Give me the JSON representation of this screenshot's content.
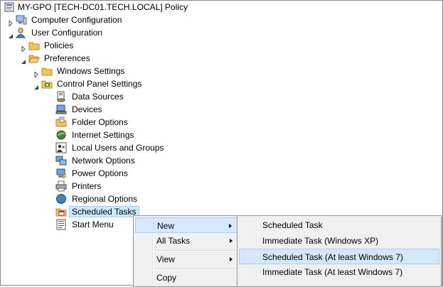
{
  "tree": {
    "root": "MY-GPO [TECH-DC01.TECH.LOCAL] Policy",
    "computer_configuration": "Computer Configuration",
    "user_configuration": "User Configuration",
    "policies": "Policies",
    "preferences": "Preferences",
    "windows_settings": "Windows Settings",
    "control_panel_settings": "Control Panel Settings",
    "items": [
      {
        "label": "Data Sources",
        "icon": "data-sources-icon"
      },
      {
        "label": "Devices",
        "icon": "devices-icon"
      },
      {
        "label": "Folder Options",
        "icon": "folder-options-icon"
      },
      {
        "label": "Internet Settings",
        "icon": "internet-settings-icon"
      },
      {
        "label": "Local Users and Groups",
        "icon": "local-users-icon"
      },
      {
        "label": "Network Options",
        "icon": "network-options-icon"
      },
      {
        "label": "Power Options",
        "icon": "power-options-icon"
      },
      {
        "label": "Printers",
        "icon": "printers-icon"
      },
      {
        "label": "Regional Options",
        "icon": "regional-options-icon"
      },
      {
        "label": "Scheduled Tasks",
        "icon": "scheduled-tasks-icon"
      },
      {
        "label": "Start Menu",
        "icon": "start-menu-icon"
      }
    ]
  },
  "context_menu": {
    "new": "New",
    "all_tasks": "All Tasks",
    "view": "View",
    "copy": "Copy"
  },
  "submenu": {
    "items": [
      "Scheduled Task",
      "Immediate Task (Windows XP)",
      "Scheduled Task (At least Windows 7)",
      "Immediate Task (At least Windows 7)"
    ]
  },
  "colors": {
    "selection": "#cce8ff",
    "menu_highlight": "#d5e8fb",
    "folder": "#f3c654"
  }
}
